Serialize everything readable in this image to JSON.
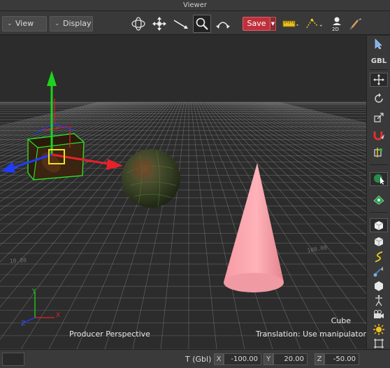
{
  "window": {
    "title": "Viewer"
  },
  "menus": [
    {
      "label": "View"
    },
    {
      "label": "Display"
    }
  ],
  "toolbar": {
    "save_label": "Save"
  },
  "viewport": {
    "camera_label": "Producer Perspective",
    "selection_label": "Cube",
    "hint_label": "Translation: Use manipulator",
    "gizmo_x": "X",
    "gizmo_y": "Y",
    "gizmo_z": "Z",
    "grid_label_left": "10.00",
    "grid_label_right": "100.00"
  },
  "rightbar": {
    "gbl_label": "GBL",
    "items": [
      "select-arrow",
      "gbl",
      "translate",
      "rotate",
      "scale",
      "magnet",
      "snap",
      "object-view",
      "material",
      "cube-solid",
      "cube-white",
      "curve",
      "light-spot",
      "polygon",
      "skeleton",
      "camera",
      "sun",
      "crop"
    ]
  },
  "status": {
    "transform_label": "T (Gbl)",
    "x_label": "X",
    "x_value": "-100.00",
    "y_label": "Y",
    "y_value": "20.00",
    "z_label": "Z",
    "z_value": "-50.00"
  },
  "colors": {
    "save": "#c0303b",
    "gizmo_x": "#e8202a",
    "gizmo_y": "#1ed21e",
    "gizmo_z": "#1e3cff",
    "cone": "#f7a0a8",
    "cube_highlight": "#2bdc2b"
  }
}
